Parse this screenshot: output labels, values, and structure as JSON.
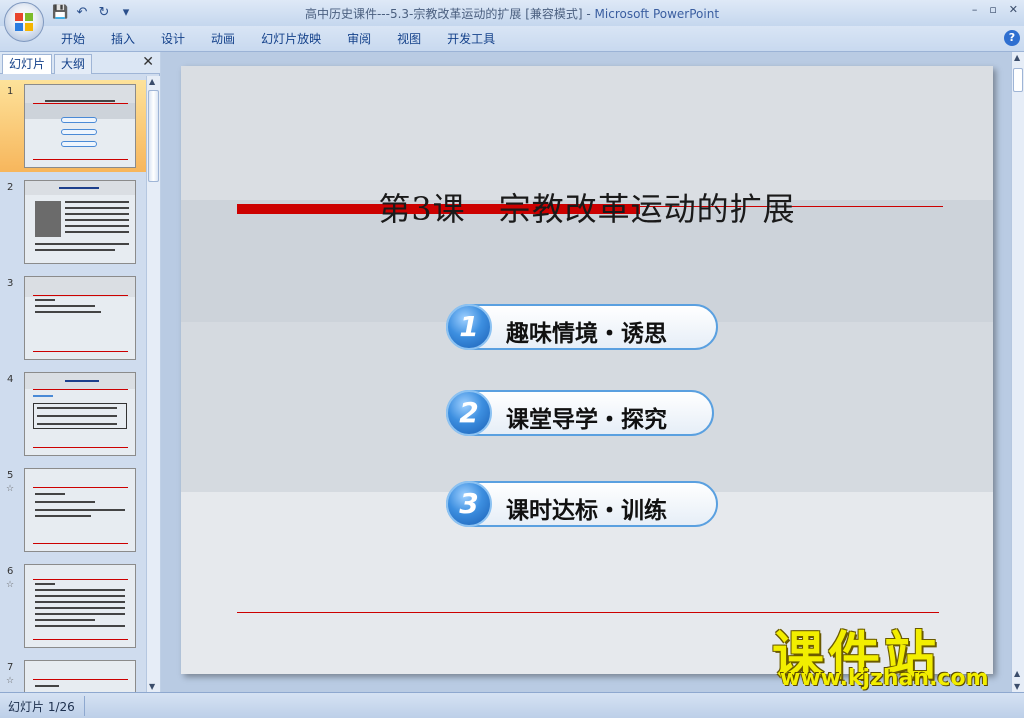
{
  "window": {
    "doc_title": "高中历史课件---5.3-宗教改革运动的扩展 [兼容模式]",
    "separator": " - ",
    "app_name": "Microsoft PowerPoint",
    "min": "–",
    "max": "▫",
    "close": "✕"
  },
  "qat": {
    "save": "💾",
    "undo": "↶",
    "redo": "↻",
    "more": "▾"
  },
  "ribbon": {
    "tabs": [
      "开始",
      "插入",
      "设计",
      "动画",
      "幻灯片放映",
      "审阅",
      "视图",
      "开发工具"
    ],
    "help": "?"
  },
  "left_pane": {
    "tab_slides": "幻灯片",
    "tab_outline": "大纲",
    "close": "✕",
    "thumbnails": [
      {
        "num": "1",
        "star": ""
      },
      {
        "num": "2",
        "star": ""
      },
      {
        "num": "3",
        "star": ""
      },
      {
        "num": "4",
        "star": ""
      },
      {
        "num": "5",
        "star": "☆"
      },
      {
        "num": "6",
        "star": "☆"
      },
      {
        "num": "7",
        "star": "☆"
      }
    ],
    "selected_index": 0
  },
  "slide": {
    "title": "第3课　宗教改革运动的扩展",
    "items": [
      {
        "num": "1",
        "label": "趣味情境・诱思"
      },
      {
        "num": "2",
        "label": "课堂导学・探究"
      },
      {
        "num": "3",
        "label": "课时达标・训练"
      }
    ]
  },
  "watermark": {
    "big": "课件站",
    "url": "www.kjzhan.com"
  },
  "status": {
    "slide_indicator": "幻灯片 1/26"
  }
}
